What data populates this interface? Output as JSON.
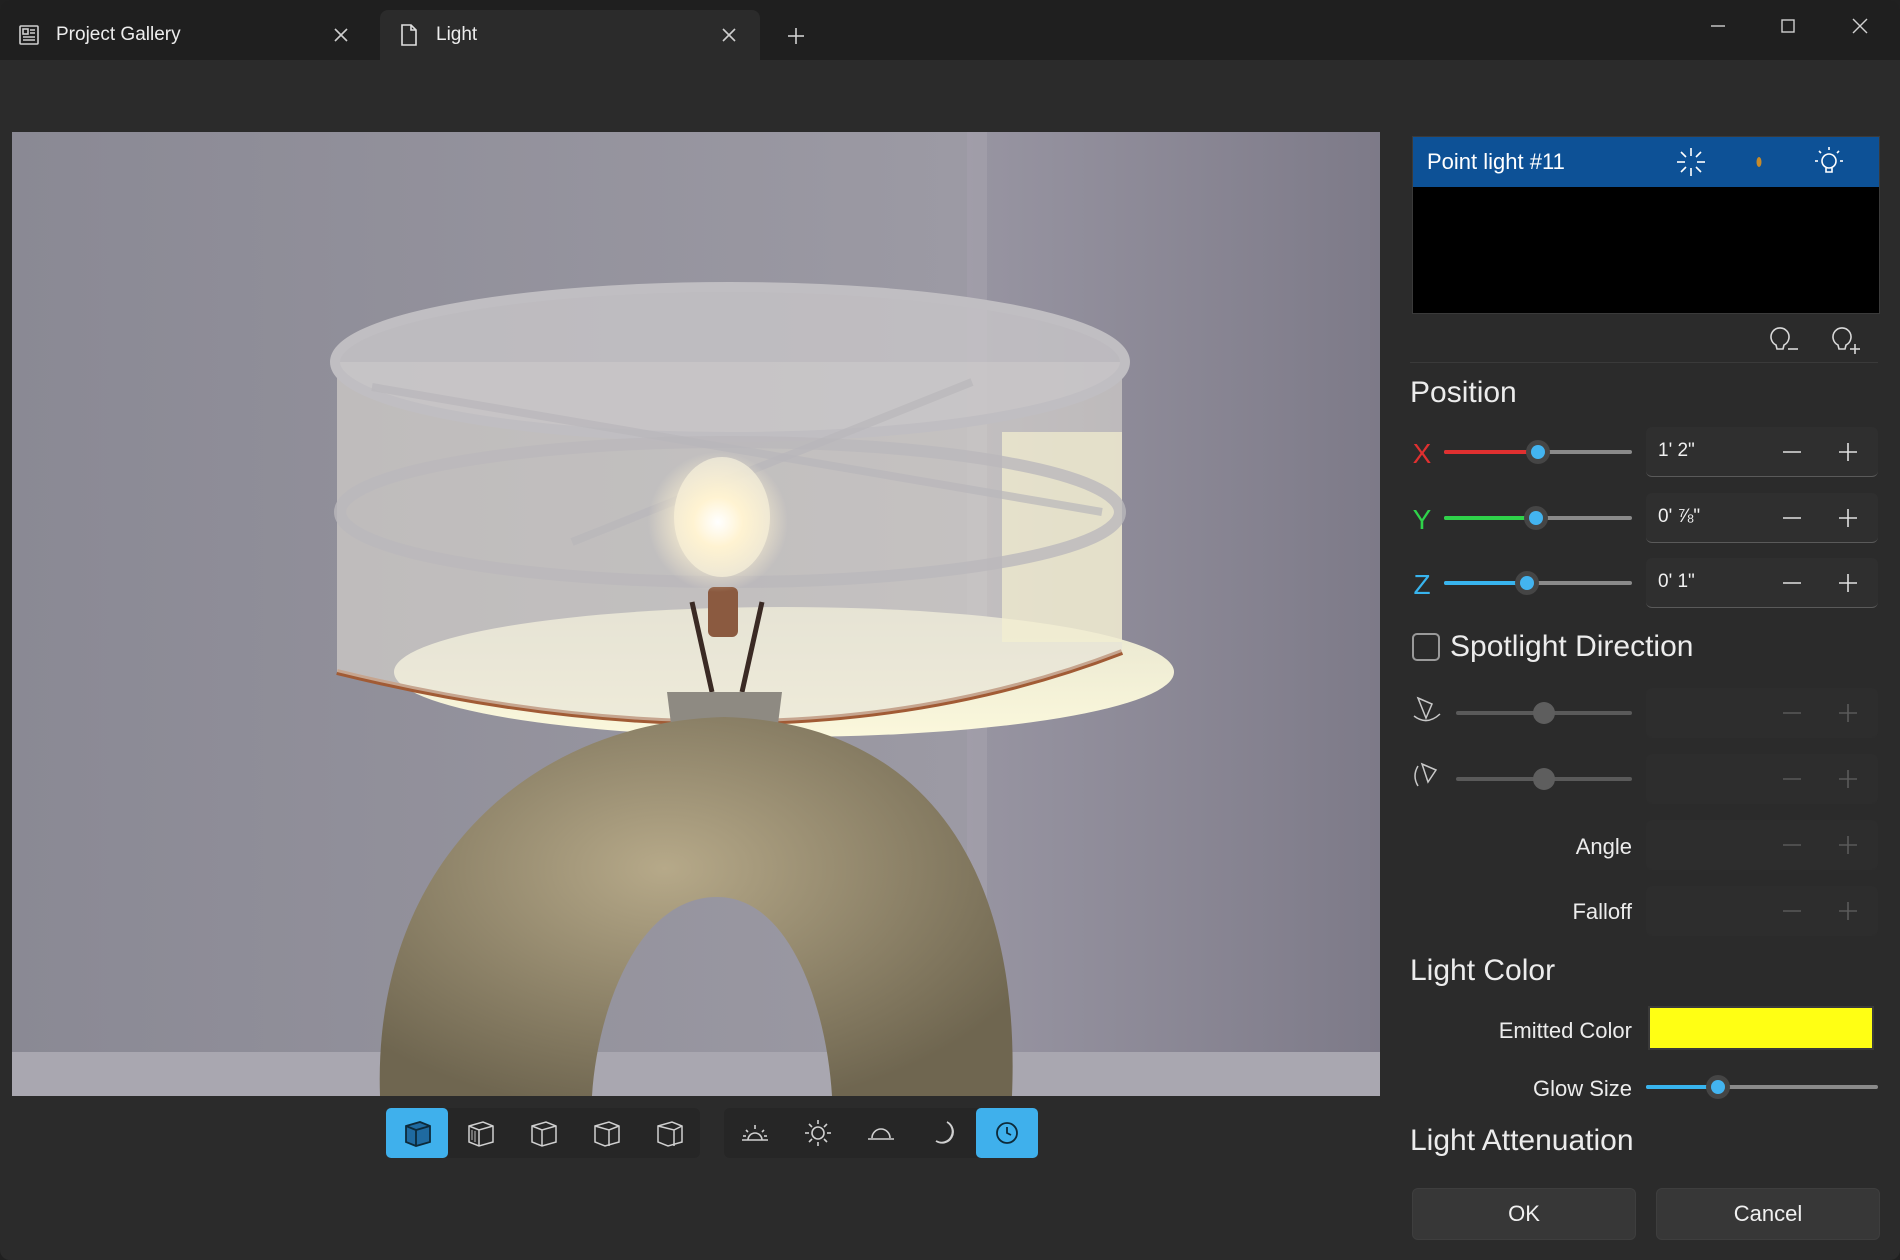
{
  "tabs": [
    {
      "label": "Project Gallery",
      "icon": "gallery-icon",
      "active": false
    },
    {
      "label": "Light",
      "icon": "document-icon",
      "active": true
    }
  ],
  "window_controls": [
    "minimize-icon",
    "maximize-icon",
    "close-icon"
  ],
  "view_toolbar": {
    "view_buttons": [
      "perspective-view-icon",
      "front-view-icon",
      "left-view-icon",
      "right-view-icon",
      "back-view-icon"
    ],
    "lighting_buttons": [
      "sunrise-icon",
      "sun-icon",
      "horizon-icon",
      "moon-icon",
      "clock-icon"
    ],
    "active_view": 0,
    "active_lighting": 4
  },
  "light_list": {
    "selected": "Point light #11",
    "row_icons": [
      "burst-icon",
      "flame-icon",
      "sun-bulb-icon"
    ],
    "actions": [
      "remove-light-icon",
      "add-light-icon"
    ]
  },
  "position": {
    "title": "Position",
    "x": {
      "label": "X",
      "value": "1' 2\"",
      "slider": 0.5,
      "color": "#e03030"
    },
    "y": {
      "label": "Y",
      "value": "0' ⅞\"",
      "slider": 0.49,
      "color": "#2fd24a"
    },
    "z": {
      "label": "Z",
      "value": "0' 1\"",
      "slider": 0.44,
      "color": "#38b4ee"
    }
  },
  "spotlight": {
    "checkbox_label": "Spotlight Direction",
    "checked": false,
    "tilt_slider": 0.5,
    "rotate_slider": 0.5,
    "angle_label": "Angle",
    "falloff_label": "Falloff"
  },
  "light_color": {
    "title": "Light Color",
    "emitted_label": "Emitted Color",
    "emitted_color": "#ffff14",
    "glow_label": "Glow Size",
    "glow_slider": 0.31
  },
  "attenuation": {
    "title": "Light Attenuation"
  },
  "footer": {
    "ok": "OK",
    "cancel": "Cancel"
  }
}
